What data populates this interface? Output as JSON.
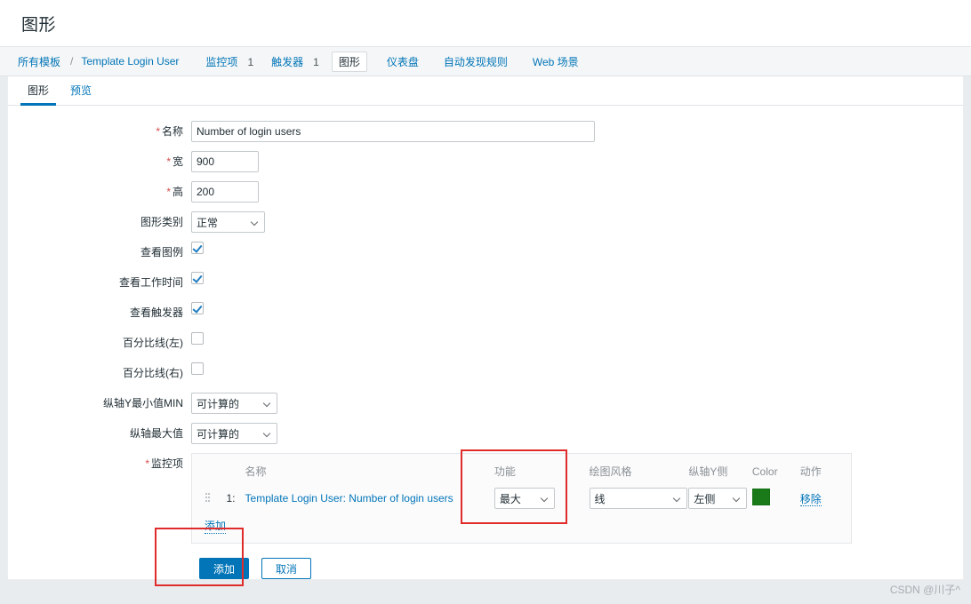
{
  "page": {
    "title": "图形",
    "watermark": "CSDN @川子^"
  },
  "breadcrumb": {
    "all_templates": "所有模板",
    "separator": "/",
    "template_name": "Template Login User",
    "items": [
      {
        "label": "监控项",
        "count": "1"
      },
      {
        "label": "触发器",
        "count": "1"
      },
      {
        "label": "图形",
        "count": ""
      },
      {
        "label": "仪表盘",
        "count": ""
      },
      {
        "label": "自动发现规则",
        "count": ""
      },
      {
        "label": "Web 场景",
        "count": ""
      }
    ]
  },
  "tabs": [
    {
      "label": "图形",
      "active": true
    },
    {
      "label": "预览",
      "active": false
    }
  ],
  "form": {
    "name": {
      "label": "名称",
      "value": "Number of login users",
      "required": true
    },
    "width": {
      "label": "宽",
      "value": "900",
      "required": true
    },
    "height": {
      "label": "高",
      "value": "200",
      "required": true
    },
    "graph_type": {
      "label": "图形类别",
      "value": "正常"
    },
    "show_legend": {
      "label": "查看图例",
      "checked": true
    },
    "show_working_time": {
      "label": "查看工作时间",
      "checked": true
    },
    "show_triggers": {
      "label": "查看触发器",
      "checked": true
    },
    "percentile_left": {
      "label": "百分比线(左)",
      "checked": false
    },
    "percentile_right": {
      "label": "百分比线(右)",
      "checked": false
    },
    "y_min": {
      "label": "纵轴Y最小值MIN",
      "value": "可计算的"
    },
    "y_max": {
      "label": "纵轴最大值",
      "value": "可计算的"
    }
  },
  "items_section": {
    "label": "监控项",
    "required": true,
    "columns": {
      "name": "名称",
      "function": "功能",
      "draw_style": "绘图风格",
      "y_side": "纵轴Y侧",
      "color": "Color",
      "action": "动作"
    },
    "rows": [
      {
        "index": "1:",
        "name": "Template Login User: Number of login users",
        "function": "最大",
        "draw_style": "线",
        "y_side": "左侧",
        "color": "#1a7a1a",
        "action": "移除"
      }
    ],
    "add_link": "添加"
  },
  "footer": {
    "submit": "添加",
    "cancel": "取消"
  },
  "theme": {
    "accent": "#0275b8",
    "annotation": "#e02b2b",
    "required": "#d64e4e"
  }
}
